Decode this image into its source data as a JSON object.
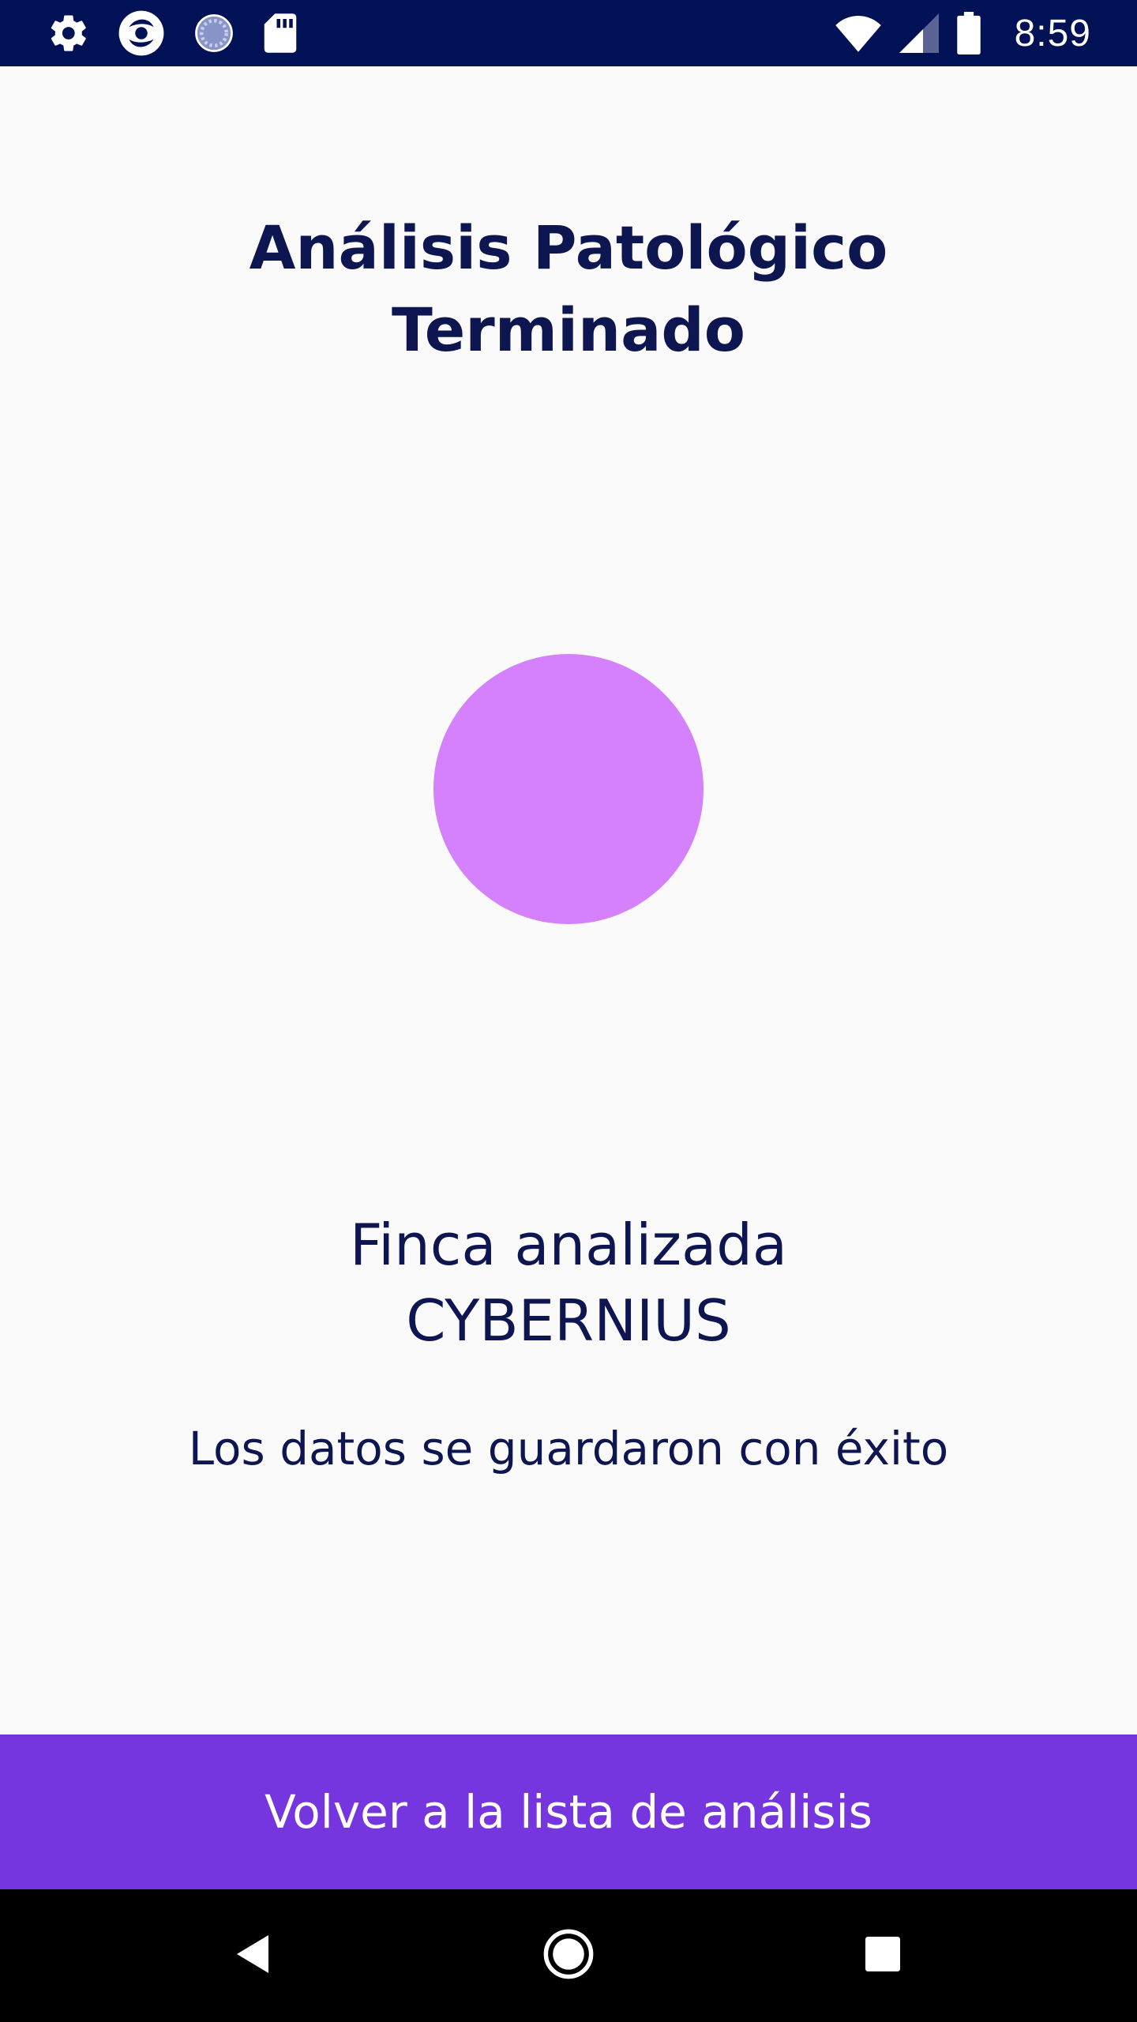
{
  "status_bar": {
    "time": "8:59",
    "left_icons": [
      "gear-icon",
      "app-logo-icon",
      "loading-icon",
      "sd-card-icon"
    ],
    "right_icons": [
      "wifi-icon",
      "signal-icon",
      "battery-icon"
    ],
    "background_color": "#001155"
  },
  "main": {
    "title_line1": "Análisis Patológico",
    "title_line2": "Terminado",
    "status_circle_color": "#d580fc",
    "farm_label": "Finca analizada",
    "farm_name": "CYBERNIUS",
    "success_message": "Los datos se guardaron con éxito"
  },
  "action": {
    "button_label": "Volver a la lista de análisis",
    "color": "#7535df"
  },
  "nav_bar": {
    "buttons": [
      "back-icon",
      "home-icon",
      "recents-icon"
    ]
  },
  "colors": {
    "text_primary": "#0d1650",
    "background": "#fafafa"
  }
}
